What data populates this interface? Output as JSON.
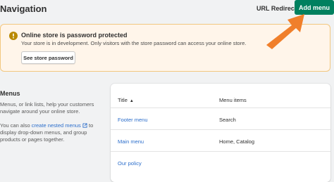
{
  "header": {
    "title": "Navigation",
    "url_redirects_label": "URL Redirects",
    "add_menu_label": "Add menu"
  },
  "banner": {
    "title": "Online store is password protected",
    "text": "Your store is in development. Only visitors with the store password can access your online store.",
    "button_label": "See store password",
    "icon": "warning-icon",
    "colors": {
      "background": "#fff5ea",
      "border": "#f2c77f",
      "icon": "#b98900"
    }
  },
  "menus_section": {
    "heading": "Menus",
    "description": "Menus, or link lists, help your customers navigate around your online store.",
    "nested_prefix": "You can also ",
    "nested_link": "create nested menus",
    "nested_suffix": " to display drop-down menus, and group products or pages together."
  },
  "table": {
    "col_title": "Title",
    "col_items": "Menu items",
    "rows": [
      {
        "title": "Footer menu",
        "items": "Search"
      },
      {
        "title": "Main menu",
        "items": "Home, Catalog"
      },
      {
        "title": "Our policy",
        "items": ""
      }
    ]
  },
  "colors": {
    "primary": "#00805f",
    "link": "#2c6ecb",
    "annotation_arrow": "#f07f2b"
  }
}
